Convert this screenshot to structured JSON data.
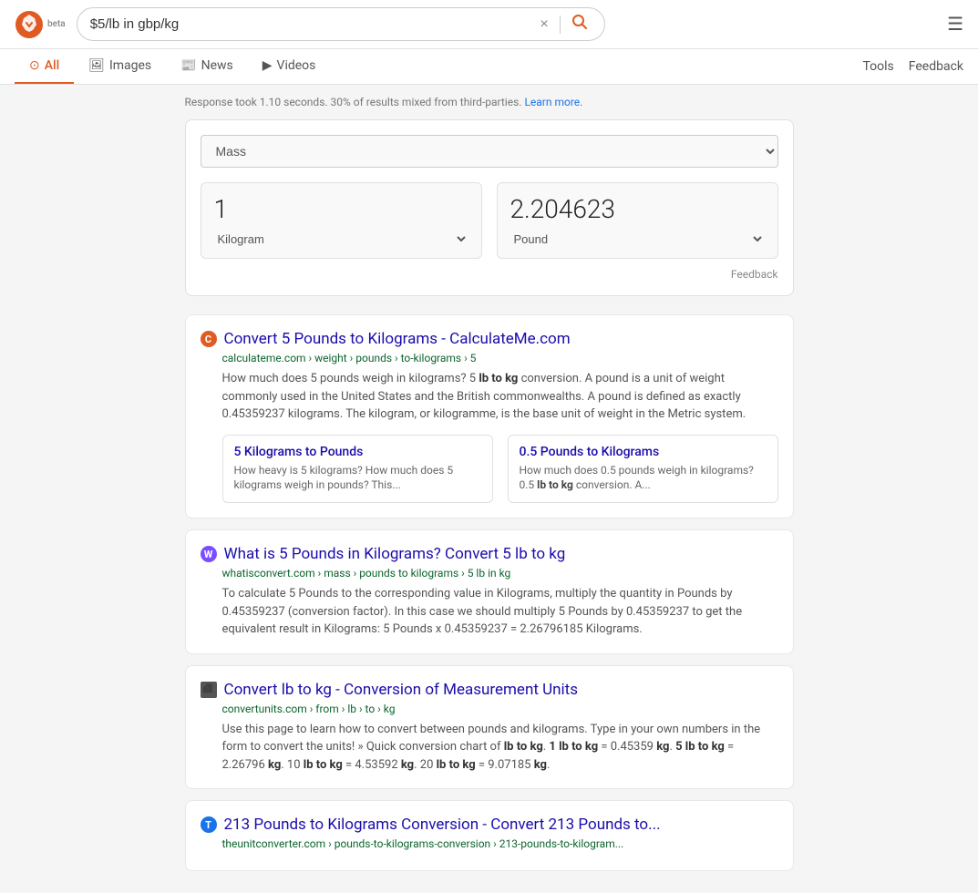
{
  "header": {
    "beta_label": "beta",
    "search_value": "$5/lb in gbp/kg",
    "clear_icon": "×",
    "search_icon": "🔍",
    "menu_icon": "☰"
  },
  "nav": {
    "tabs": [
      {
        "id": "all",
        "label": "All",
        "icon": "🔍",
        "active": true
      },
      {
        "id": "images",
        "label": "Images",
        "icon": "🖼"
      },
      {
        "id": "news",
        "label": "News",
        "icon": "📰"
      },
      {
        "id": "videos",
        "label": "Videos",
        "icon": "▶"
      }
    ],
    "right_links": [
      {
        "id": "tools",
        "label": "Tools"
      },
      {
        "id": "feedback",
        "label": "Feedback"
      }
    ]
  },
  "response_info": {
    "text": "Response took 1.10 seconds. 30% of results mixed from third-parties.",
    "link_text": "Learn more.",
    "link_href": "#"
  },
  "converter": {
    "type_label": "Mass",
    "input_value": "1",
    "input_unit": "Kilogram",
    "output_value": "2.204623",
    "output_unit": "Pound",
    "feedback_label": "Feedback"
  },
  "results": [
    {
      "favicon_char": "C",
      "favicon_color": "#e05a24",
      "title": "Convert 5 Pounds to Kilograms - CalculateMe.com",
      "url": "calculateme.com › weight › pounds › to-kilograms › 5",
      "snippet": "How much does 5 pounds weigh in kilograms? 5 lb to kg conversion. A pound is a unit of weight commonly used in the United States and the British commonwealths. A pound is defined as exactly 0.45359237 kilograms. The kilogram, or kilogramme, is the base unit of weight in the Metric system.",
      "snippet_bold": [
        "lb to kg"
      ],
      "sub_results": [
        {
          "title": "5 Kilograms to Pounds",
          "snippet": "How heavy is 5 kilograms? How much does 5 kilograms weigh in pounds? This..."
        },
        {
          "title": "0.5 Pounds to Kilograms",
          "snippet": "How much does 0.5 pounds weigh in kilograms? 0.5 lb to kg conversion. A..."
        }
      ]
    },
    {
      "favicon_char": "W",
      "favicon_color": "#7c4dff",
      "title": "What is 5 Pounds in Kilograms? Convert 5 lb to kg",
      "url": "whatisconvert.com  › mass › pounds to kilograms › 5 lb in kg",
      "snippet": "To calculate 5 Pounds to the corresponding value in Kilograms, multiply the quantity in Pounds by 0.45359237 (conversion factor). In this case we should multiply 5 Pounds by 0.45359237 to get the equivalent result in Kilograms: 5 Pounds x 0.45359237 = 2.26796185 Kilograms.",
      "snippet_bold": [],
      "sub_results": []
    },
    {
      "favicon_char": "⬛",
      "favicon_color": "#555",
      "title": "Convert lb to kg - Conversion of Measurement Units",
      "url": "convertunits.com › from › lb › to › kg",
      "snippet": "Use this page to learn how to convert between pounds and kilograms. Type in your own numbers in the form to convert the units! » Quick conversion chart of lb to kg. 1 lb to kg = 0.45359 kg. 5 lb to kg = 2.26796 kg. 10 lb to kg = 4.53592 kg. 20 lb to kg = 9.07185 kg.",
      "snippet_bold": [
        "lb to kg",
        "lb to kg",
        "1 lb to kg",
        "5 lb to kg",
        "lb to kg",
        "10 lb to kg",
        "kg",
        "20 lb to kg",
        "kg"
      ],
      "sub_results": []
    },
    {
      "favicon_char": "T",
      "favicon_color": "#1a73e8",
      "title": "213 Pounds to Kilograms Conversion - Convert 213 Pounds to...",
      "url": "theunitconverter.com › pounds-to-kilograms-conversion › 213-pounds-to-kilogram...",
      "snippet": "",
      "snippet_bold": [],
      "sub_results": []
    }
  ]
}
